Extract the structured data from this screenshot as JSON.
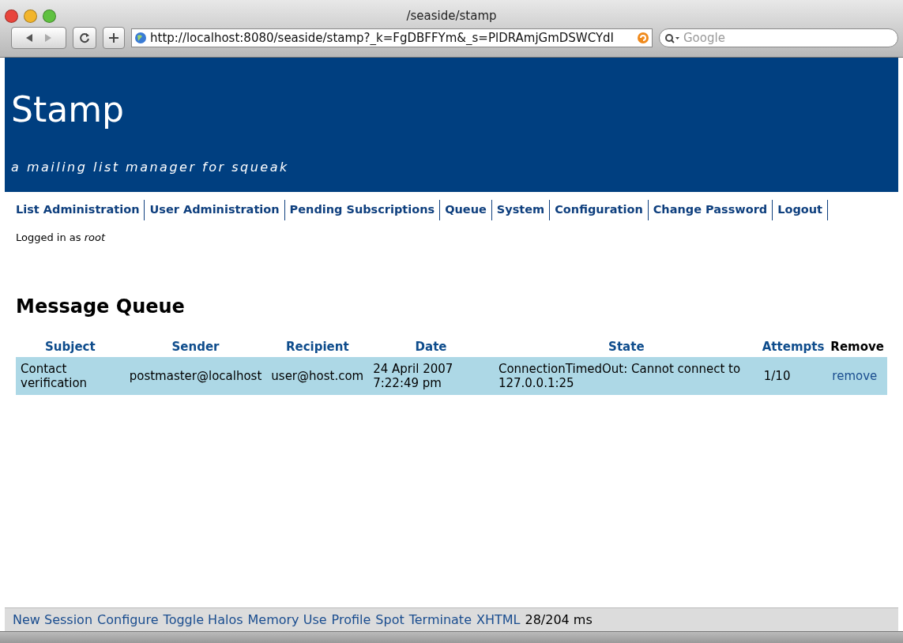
{
  "window": {
    "title": "/seaside/stamp"
  },
  "toolbar": {
    "url": "http://localhost:8080/seaside/stamp?_k=FgDBFFYm&_s=PlDRAmjGmDSWCYdI",
    "search_placeholder": "Google"
  },
  "header": {
    "title": "Stamp",
    "subtitle": "a mailing list manager for squeak"
  },
  "nav": [
    "List Administration",
    "User Administration",
    "Pending Subscriptions",
    "Queue",
    "System",
    "Configuration",
    "Change Password",
    "Logout"
  ],
  "login": {
    "prefix": "Logged in as",
    "user": "root"
  },
  "heading": "Message Queue",
  "table": {
    "columns": [
      {
        "label": "Subject",
        "link": true
      },
      {
        "label": "Sender",
        "link": true
      },
      {
        "label": "Recipient",
        "link": true
      },
      {
        "label": "Date",
        "link": true
      },
      {
        "label": "State",
        "link": true
      },
      {
        "label": "Attempts",
        "link": true
      },
      {
        "label": "Remove",
        "link": false
      }
    ],
    "rows": [
      {
        "cells": [
          "Contact verification",
          "postmaster@localhost",
          "user@host.com",
          "24 April 2007 7:22:49 pm",
          "ConnectionTimedOut: Cannot connect to 127.0.0.1:25",
          "1/10"
        ],
        "action": "remove"
      }
    ]
  },
  "footer": {
    "links": [
      "New Session",
      "Configure",
      "Toggle Halos",
      "Memory Use",
      "Profile",
      "Spot",
      "Terminate",
      "XHTML"
    ],
    "timing": "28/204 ms"
  }
}
